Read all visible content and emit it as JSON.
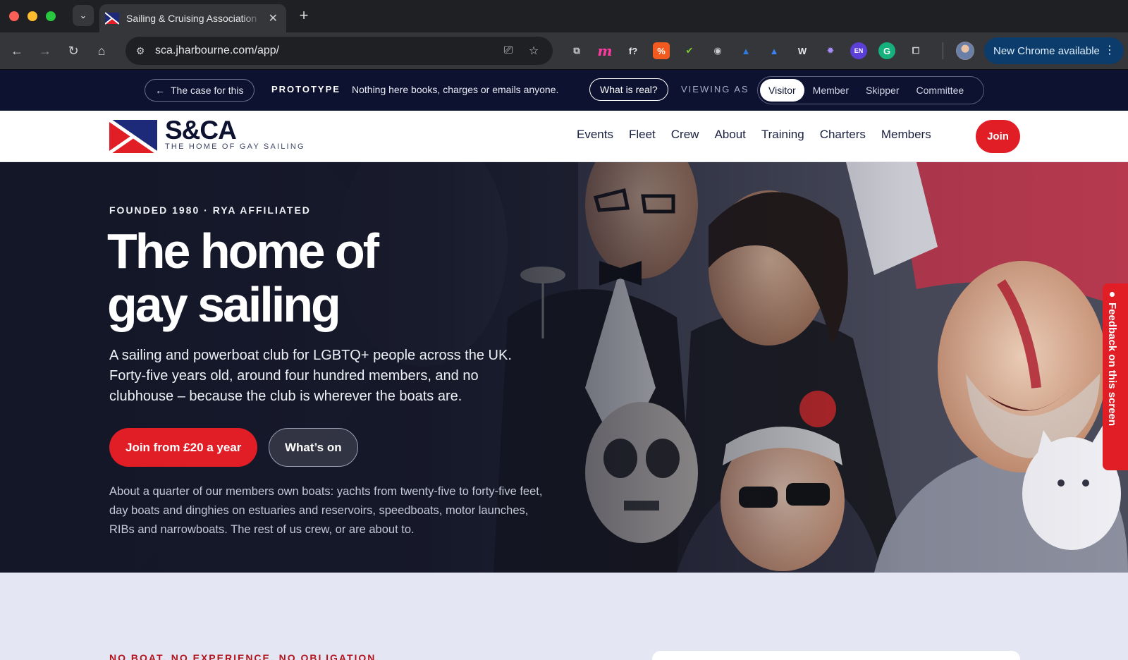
{
  "browser": {
    "tab_title": "Sailing & Cruising Association",
    "url": "sca.jharbourne.com/app/",
    "update_label": "New Chrome available",
    "extensions": [
      {
        "name": "translate",
        "glyph": "⧉",
        "color": "#c9c9c9",
        "bg": "transparent"
      },
      {
        "name": "m",
        "glyph": "m",
        "color": "#ff3aa0",
        "bg": "transparent"
      },
      {
        "name": "formula",
        "glyph": "f?",
        "color": "#e8e8e8",
        "bg": "transparent"
      },
      {
        "name": "percent",
        "glyph": "%",
        "color": "#ffffff",
        "bg": "#f35a1f"
      },
      {
        "name": "color-check",
        "glyph": "✔",
        "color": "#7ccf2e",
        "bg": "transparent"
      },
      {
        "name": "camera",
        "glyph": "◉",
        "color": "#c9c9c9",
        "bg": "transparent"
      },
      {
        "name": "triangle-a",
        "glyph": "▲",
        "color": "#2f7de1",
        "bg": "transparent"
      },
      {
        "name": "triangle-b",
        "glyph": "▲",
        "color": "#3b82f6",
        "bg": "transparent"
      },
      {
        "name": "w",
        "glyph": "W",
        "color": "#e8e8e8",
        "bg": "transparent"
      },
      {
        "name": "gear",
        "glyph": "✹",
        "color": "#a78bfa",
        "bg": "transparent"
      },
      {
        "name": "en",
        "glyph": "EN",
        "color": "#ffffff",
        "bg": "#5b3fd6"
      },
      {
        "name": "grammarly",
        "glyph": "G",
        "color": "#ffffff",
        "bg": "#15b07b"
      },
      {
        "name": "puzzle",
        "glyph": "⧠",
        "color": "#d0d0d0",
        "bg": "transparent"
      }
    ]
  },
  "protobar": {
    "back_label": "The case for this",
    "prototype_label": "PROTOTYPE",
    "prototype_text": "Nothing here books, charges or emails anyone.",
    "real_label": "What is real?",
    "viewing_label": "VIEWING AS",
    "roles": [
      "Visitor",
      "Member",
      "Skipper",
      "Committee"
    ],
    "active_role": "Visitor"
  },
  "header": {
    "brand": "S&CA",
    "tagline": "THE HOME OF GAY SAILING",
    "nav": [
      "Events",
      "Fleet",
      "Crew",
      "About",
      "Training",
      "Charters",
      "Members"
    ],
    "join_label": "Join",
    "accent": "#e11d26",
    "navy": "#0c1230"
  },
  "hero": {
    "eyebrow": "FOUNDED 1980 · RYA AFFILIATED",
    "title_line1": "The home of",
    "title_line2": "gay sailing",
    "lead": "A sailing and powerboat club for LGBTQ+ people across the UK. Forty-five years old, around four hundred members, and no clubhouse – because the club is wherever the boats are.",
    "cta_primary": "Join from £20 a year",
    "cta_secondary": "What’s on",
    "note": "About a quarter of our members own boats: yachts from twenty-five to forty-five feet, day boats and dinghies on estuaries and reservoirs, speedboats, motor launches, RIBs and narrowboats. The rest of us crew, or are about to."
  },
  "feedback": {
    "label": "Feedback on this screen"
  },
  "lower": {
    "eyebrow": "NO BOAT. NO EXPERIENCE. NO OBLIGATION."
  }
}
